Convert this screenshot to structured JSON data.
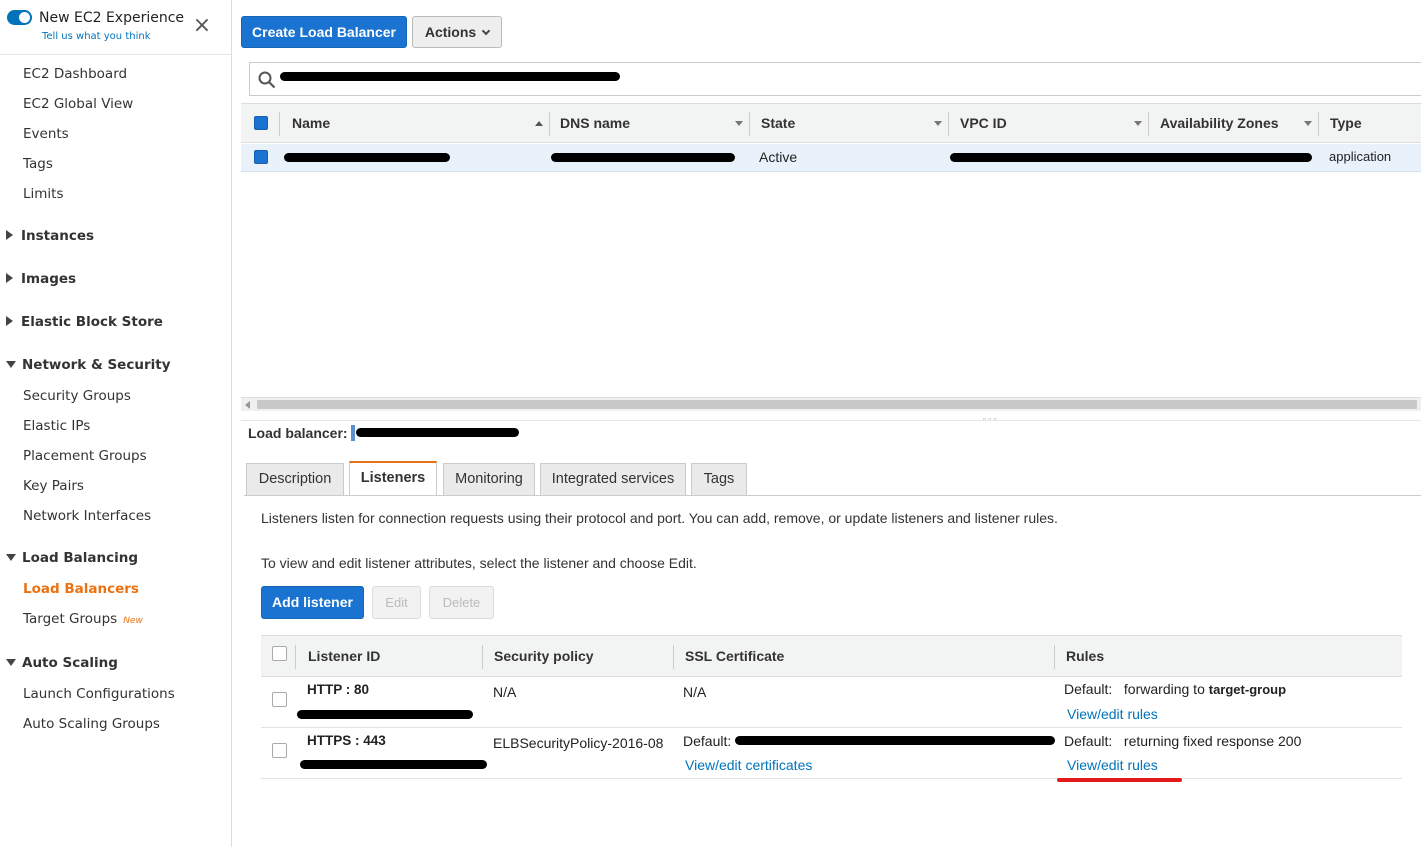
{
  "sidebar": {
    "ec2_title": "New EC2 Experience",
    "ec2_feedback": "Tell us what you think",
    "close_icon": "×",
    "top_items": [
      "EC2 Dashboard",
      "EC2 Global View",
      "Events",
      "Tags",
      "Limits"
    ],
    "sections": {
      "instances": "Instances",
      "images": "Images",
      "ebs": "Elastic Block Store",
      "network": "Network & Security",
      "load_balancing": "Load Balancing",
      "auto_scaling": "Auto Scaling"
    },
    "network_items": [
      "Security Groups",
      "Elastic IPs",
      "Placement Groups",
      "Key Pairs",
      "Network Interfaces"
    ],
    "lb_items": {
      "load_balancers": "Load Balancers",
      "target_groups": "Target Groups",
      "target_groups_badge": "New"
    },
    "as_items": [
      "Launch Configurations",
      "Auto Scaling Groups"
    ]
  },
  "toolbar": {
    "create_label": "Create Load Balancer",
    "actions_label": "Actions"
  },
  "search": {
    "placeholder": ""
  },
  "lb_table": {
    "headers": {
      "name": "Name",
      "dns": "DNS name",
      "state": "State",
      "vpc": "VPC ID",
      "az": "Availability Zones",
      "type": "Type"
    },
    "row": {
      "state": "Active",
      "type": "application"
    }
  },
  "details": {
    "lb_label": "Load balancer:",
    "tabs": [
      "Description",
      "Listeners",
      "Monitoring",
      "Integrated services",
      "Tags"
    ],
    "active_tab": "Listeners",
    "intro": "Listeners listen for connection requests using their protocol and port. You can add, remove, or update listeners and listener rules.",
    "edit_hint": "To view and edit listener attributes, select the listener and choose Edit.",
    "add_listener": "Add listener",
    "edit": "Edit",
    "delete": "Delete"
  },
  "listener_table": {
    "headers": {
      "id": "Listener ID",
      "policy": "Security policy",
      "cert": "SSL Certificate",
      "rules": "Rules"
    },
    "rows": [
      {
        "id": "HTTP : 80",
        "policy": "N/A",
        "cert": "N/A",
        "rules_prefix": "Default:",
        "rules_text": "forwarding to",
        "rules_target": "target-group",
        "rules_link": "View/edit rules"
      },
      {
        "id": "HTTPS : 443",
        "policy": "ELBSecurityPolicy-2016-08",
        "cert_prefix": "Default:",
        "cert_link": "View/edit certificates",
        "rules_prefix": "Default:",
        "rules_text": "returning fixed response 200",
        "rules_link": "View/edit rules"
      }
    ]
  },
  "colors": {
    "primary": "#1a73d0",
    "accent": "#ec7211",
    "link": "#0073bb",
    "highlight": "#e21a1a"
  }
}
